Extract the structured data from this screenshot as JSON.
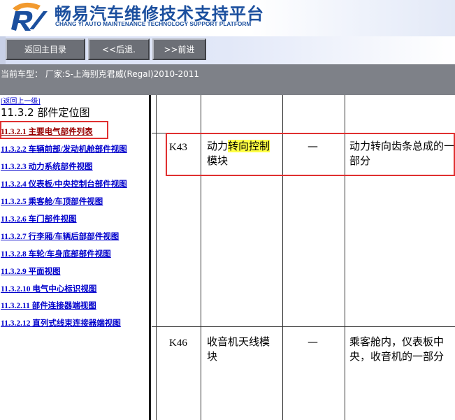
{
  "header": {
    "title": "畅易汽车维修技术支持平台",
    "subtitle": "CHANG YI AUTO MAINTENANCE TECHNOLOGY SUPPORT PLATFORM",
    "logo_icon": "changyi-logo-icon"
  },
  "nav": {
    "buttons": [
      {
        "label": "返回主目录"
      },
      {
        "label": "<<后退."
      },
      {
        "label": ">>前进"
      }
    ]
  },
  "car": {
    "label": "当前车型： 厂家:S-上海别克君威(Regal)2010-2011"
  },
  "sidebar": {
    "back_link": "[返回上一级]",
    "section_title": "11.3.2 部件定位图",
    "items": [
      {
        "label": "11.3.2.1 主要电气部件列表",
        "active": true
      },
      {
        "label": "11.3.2.2 车辆前部/发动机舱部件视图"
      },
      {
        "label": "11.3.2.3 动力系统部件视图"
      },
      {
        "label": "11.3.2.4 仪表板/中央控制台部件视图"
      },
      {
        "label": "11.3.2.5 乘客舱/车顶部件视图"
      },
      {
        "label": "11.3.2.6 车门部件视图"
      },
      {
        "label": "11.3.2.7 行李厢/车辆后部部件视图"
      },
      {
        "label": "11.3.2.8 车轮/车身底部部件视图"
      },
      {
        "label": "11.3.2.9 平面视图"
      },
      {
        "label": "11.3.2.10 电气中心标识视图"
      },
      {
        "label": "11.3.2.11 部件连接器端视图"
      },
      {
        "label": "11.3.2.12 直列式线束连接器端视图"
      }
    ]
  },
  "table": {
    "rows": [
      {
        "code": "K43",
        "name_pre": "动力",
        "name_highlight": "转向控制",
        "name_post": "模块",
        "view": "—",
        "location": "动力转向齿条总成的一部分"
      },
      {
        "code": "K46",
        "name_pre": "收音机天线模块",
        "name_highlight": "",
        "name_post": "",
        "view": "—",
        "location": "乘客舱内，仪表板中央，收音机的一部分"
      }
    ]
  },
  "colors": {
    "brand_blue": "#1b4f9e",
    "link_blue": "#0000cc",
    "annotation_red": "#e03030",
    "text_highlight": "#ffff44"
  }
}
